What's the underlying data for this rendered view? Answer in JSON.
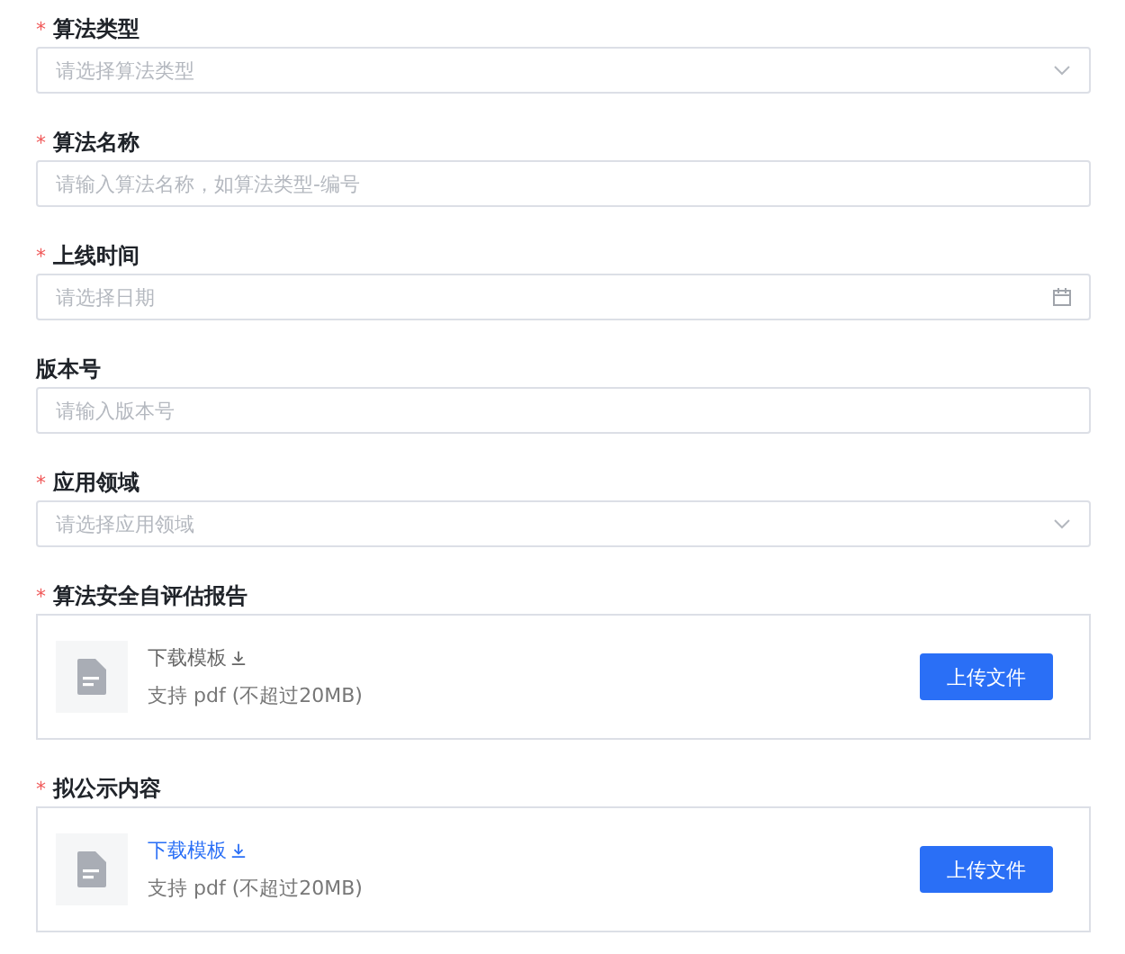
{
  "fields": [
    {
      "kind": "select",
      "required_mark": "*",
      "label": "算法类型",
      "placeholder": "请选择算法类型"
    },
    {
      "kind": "text",
      "required_mark": "*",
      "label": "算法名称",
      "placeholder": "请输入算法名称，如算法类型-编号"
    },
    {
      "kind": "date",
      "required_mark": "*",
      "label": "上线时间",
      "placeholder": "请选择日期"
    },
    {
      "kind": "text",
      "label": "版本号",
      "placeholder": "请输入版本号"
    },
    {
      "kind": "select",
      "required_mark": "*",
      "label": "应用领域",
      "placeholder": "请选择应用领域"
    },
    {
      "kind": "upload",
      "required_mark": "*",
      "label": "算法安全自评估报告",
      "link": "下载模板",
      "link_highlighted": false,
      "hint": "支持 pdf (不超过20MB)",
      "button": "上传文件"
    },
    {
      "kind": "upload",
      "required_mark": "*",
      "label": "拟公示内容",
      "link": "下载模板",
      "link_highlighted": true,
      "hint": "支持 pdf (不超过20MB)",
      "button": "上传文件"
    }
  ]
}
